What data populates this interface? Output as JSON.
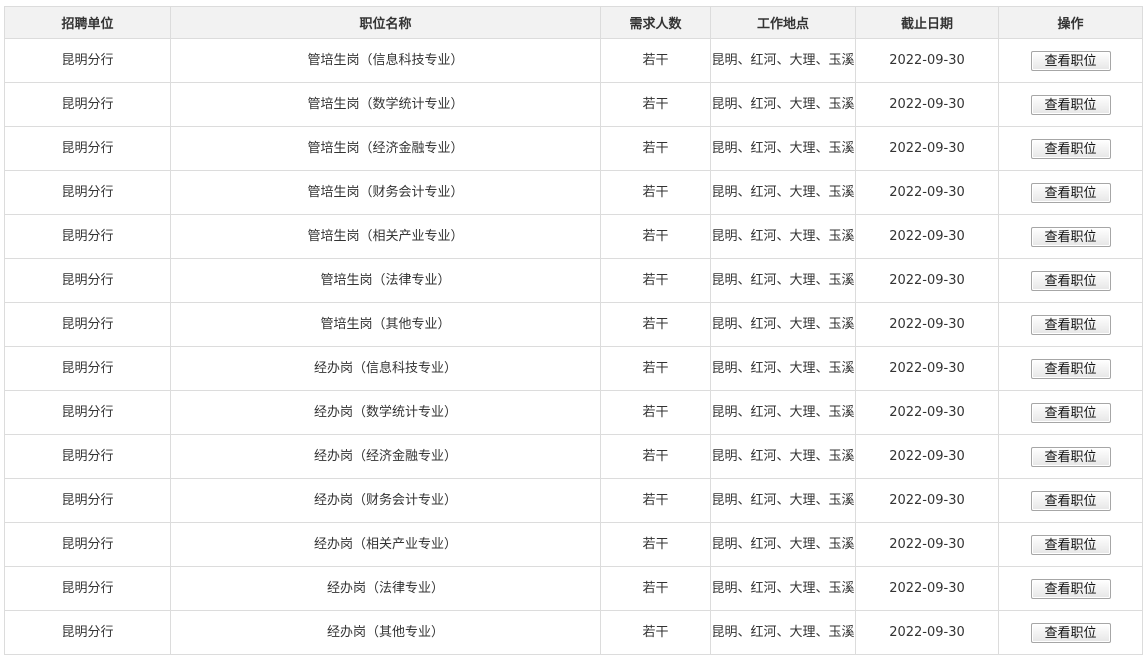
{
  "table": {
    "headers": [
      "招聘单位",
      "职位名称",
      "需求人数",
      "工作地点",
      "截止日期",
      "操作"
    ],
    "rows": [
      {
        "unit": "昆明分行",
        "position": "管培生岗（信息科技专业）",
        "count": "若干",
        "location": "昆明、红河、大理、玉溪",
        "deadline": "2022-09-30",
        "action": "查看职位"
      },
      {
        "unit": "昆明分行",
        "position": "管培生岗（数学统计专业）",
        "count": "若干",
        "location": "昆明、红河、大理、玉溪",
        "deadline": "2022-09-30",
        "action": "查看职位"
      },
      {
        "unit": "昆明分行",
        "position": "管培生岗（经济金融专业）",
        "count": "若干",
        "location": "昆明、红河、大理、玉溪",
        "deadline": "2022-09-30",
        "action": "查看职位"
      },
      {
        "unit": "昆明分行",
        "position": "管培生岗（财务会计专业）",
        "count": "若干",
        "location": "昆明、红河、大理、玉溪",
        "deadline": "2022-09-30",
        "action": "查看职位"
      },
      {
        "unit": "昆明分行",
        "position": "管培生岗（相关产业专业）",
        "count": "若干",
        "location": "昆明、红河、大理、玉溪",
        "deadline": "2022-09-30",
        "action": "查看职位"
      },
      {
        "unit": "昆明分行",
        "position": "管培生岗（法律专业）",
        "count": "若干",
        "location": "昆明、红河、大理、玉溪",
        "deadline": "2022-09-30",
        "action": "查看职位"
      },
      {
        "unit": "昆明分行",
        "position": "管培生岗（其他专业）",
        "count": "若干",
        "location": "昆明、红河、大理、玉溪",
        "deadline": "2022-09-30",
        "action": "查看职位"
      },
      {
        "unit": "昆明分行",
        "position": "经办岗（信息科技专业）",
        "count": "若干",
        "location": "昆明、红河、大理、玉溪",
        "deadline": "2022-09-30",
        "action": "查看职位"
      },
      {
        "unit": "昆明分行",
        "position": "经办岗（数学统计专业）",
        "count": "若干",
        "location": "昆明、红河、大理、玉溪",
        "deadline": "2022-09-30",
        "action": "查看职位"
      },
      {
        "unit": "昆明分行",
        "position": "经办岗（经济金融专业）",
        "count": "若干",
        "location": "昆明、红河、大理、玉溪",
        "deadline": "2022-09-30",
        "action": "查看职位"
      },
      {
        "unit": "昆明分行",
        "position": "经办岗（财务会计专业）",
        "count": "若干",
        "location": "昆明、红河、大理、玉溪",
        "deadline": "2022-09-30",
        "action": "查看职位"
      },
      {
        "unit": "昆明分行",
        "position": "经办岗（相关产业专业）",
        "count": "若干",
        "location": "昆明、红河、大理、玉溪",
        "deadline": "2022-09-30",
        "action": "查看职位"
      },
      {
        "unit": "昆明分行",
        "position": "经办岗（法律专业）",
        "count": "若干",
        "location": "昆明、红河、大理、玉溪",
        "deadline": "2022-09-30",
        "action": "查看职位"
      },
      {
        "unit": "昆明分行",
        "position": "经办岗（其他专业）",
        "count": "若干",
        "location": "昆明、红河、大理、玉溪",
        "deadline": "2022-09-30",
        "action": "查看职位"
      }
    ]
  },
  "colors": {
    "header_bg": "#f2f2f2",
    "border": "#dcdcdc",
    "text": "#333333"
  }
}
